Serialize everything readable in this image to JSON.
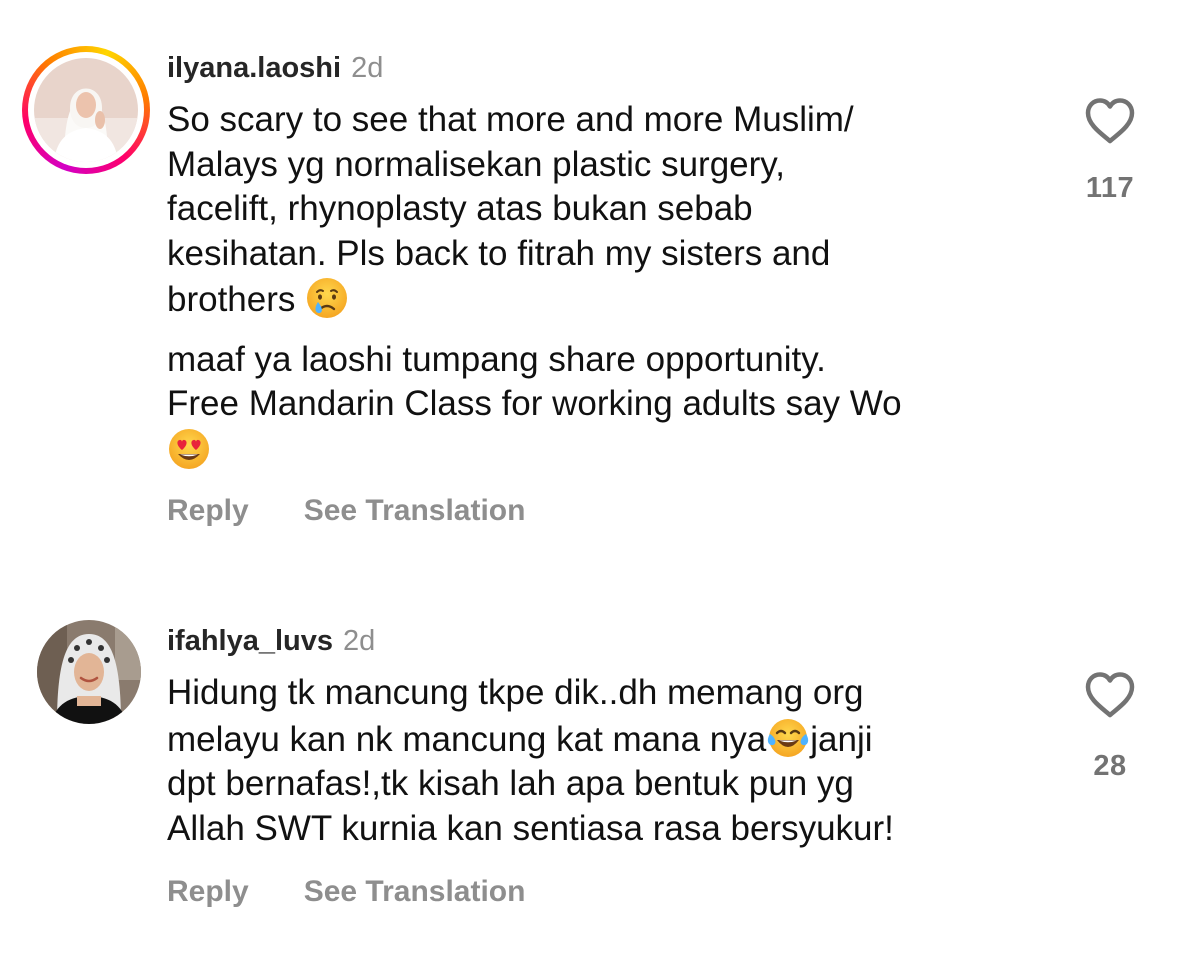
{
  "comments": [
    {
      "username": "ilyana.laoshi",
      "age": "2d",
      "paragraph1": "So scary to see that more and more Muslim/\nMalays yg normalisekan plastic surgery,\nfacelift, rhynoplasty atas bukan sebab\nkesihatan. Pls back to fitrah my sisters and\nbrothers ",
      "paragraph2": "maaf ya laoshi tumpang share opportunity.\nFree Mandarin Class for working adults say Wo\n",
      "emoji1": "crying-face",
      "emoji2": "heart-eyes-face",
      "reply_label": "Reply",
      "translate_label": "See Translation",
      "likes": "117",
      "has_story_ring": true
    },
    {
      "username": "ifahlya_luvs",
      "age": "2d",
      "text_before_emoji": "Hidung tk mancung tkpe dik..dh memang org\nmelayu kan nk mancung kat mana nya",
      "text_after_emoji": "janji\ndpt bernafas!,tk kisah lah apa bentuk pun yg\nAllah SWT kurnia kan sentiasa rasa bersyukur!",
      "emoji": "tears-of-joy-face",
      "reply_label": "Reply",
      "translate_label": "See Translation",
      "likes": "28",
      "has_story_ring": false
    }
  ],
  "colors": {
    "username": "#262626",
    "secondary": "#8e8e8e",
    "like_count": "#737373",
    "story_ring": "#ff0069"
  }
}
